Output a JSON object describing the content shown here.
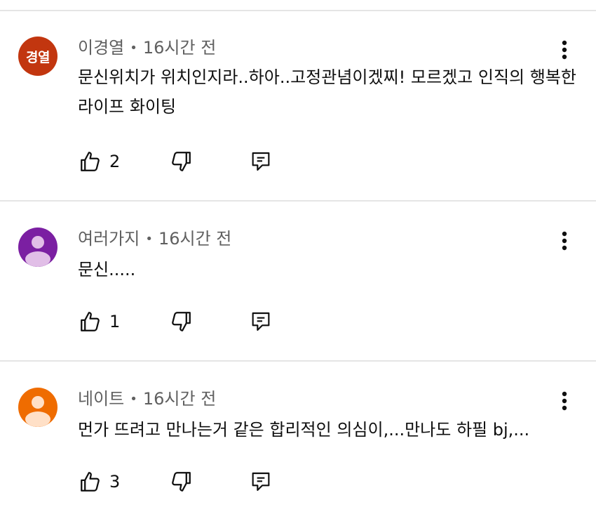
{
  "comments": [
    {
      "author": "이경열",
      "avatar_initials": "경열",
      "avatar_color": "#c2360f",
      "separator": "•",
      "time": "16시간 전",
      "text": "문신위치가 위치인지라..하아..고정관념이겠찌! 모르겠고 인직의 행복한 라이프 화이팅",
      "like_count": "2",
      "icons": {
        "like": "thumbs-up-icon",
        "dislike": "thumbs-down-icon",
        "reply": "reply-icon",
        "more": "more-vert-icon"
      }
    },
    {
      "author": "여러가지",
      "avatar_color": "#7b1fa2",
      "avatar_icon": "default-person-icon",
      "separator": "•",
      "time": "16시간 전",
      "text": "문신.....",
      "like_count": "1",
      "icons": {
        "like": "thumbs-up-icon",
        "dislike": "thumbs-down-icon",
        "reply": "reply-icon",
        "more": "more-vert-icon"
      }
    },
    {
      "author": "네이트",
      "avatar_color": "#ef6c00",
      "avatar_icon": "default-person-icon",
      "separator": "•",
      "time": "16시간 전",
      "text": "먼가 뜨려고 만나는거 같은 합리적인 의심이,...만나도 하필 bj,...",
      "like_count": "3",
      "icons": {
        "like": "thumbs-up-icon",
        "dislike": "thumbs-down-icon",
        "reply": "reply-icon",
        "more": "more-vert-icon"
      }
    }
  ],
  "colors": {
    "divider": "#e5e5e5",
    "meta_text": "#606060",
    "body_text": "#0f0f0f"
  }
}
